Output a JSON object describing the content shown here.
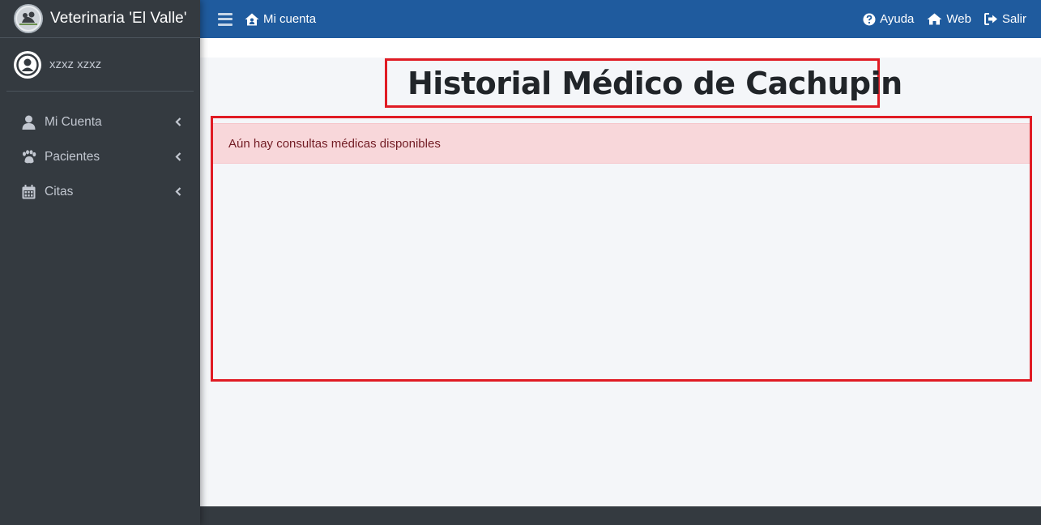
{
  "brand": {
    "name": "Veterinaria 'El Valle'"
  },
  "user": {
    "name": "xzxz xzxz"
  },
  "sidebar": {
    "items": [
      {
        "label": "Mi Cuenta",
        "icon": "user-icon"
      },
      {
        "label": "Pacientes",
        "icon": "paw-icon"
      },
      {
        "label": "Citas",
        "icon": "calendar-icon"
      }
    ]
  },
  "topbar": {
    "account_label": "Mi cuenta",
    "help_label": "Ayuda",
    "web_label": "Web",
    "logout_label": "Salir"
  },
  "main": {
    "title": "Historial Médico de Cachupin",
    "alert_text": "Aún hay consultas médicas disponibles"
  },
  "colors": {
    "navbar": "#1f5b9e",
    "sidebar": "#343a40",
    "highlight_border": "#e01b24",
    "alert_bg": "#f8d7da",
    "alert_text": "#721c24"
  }
}
